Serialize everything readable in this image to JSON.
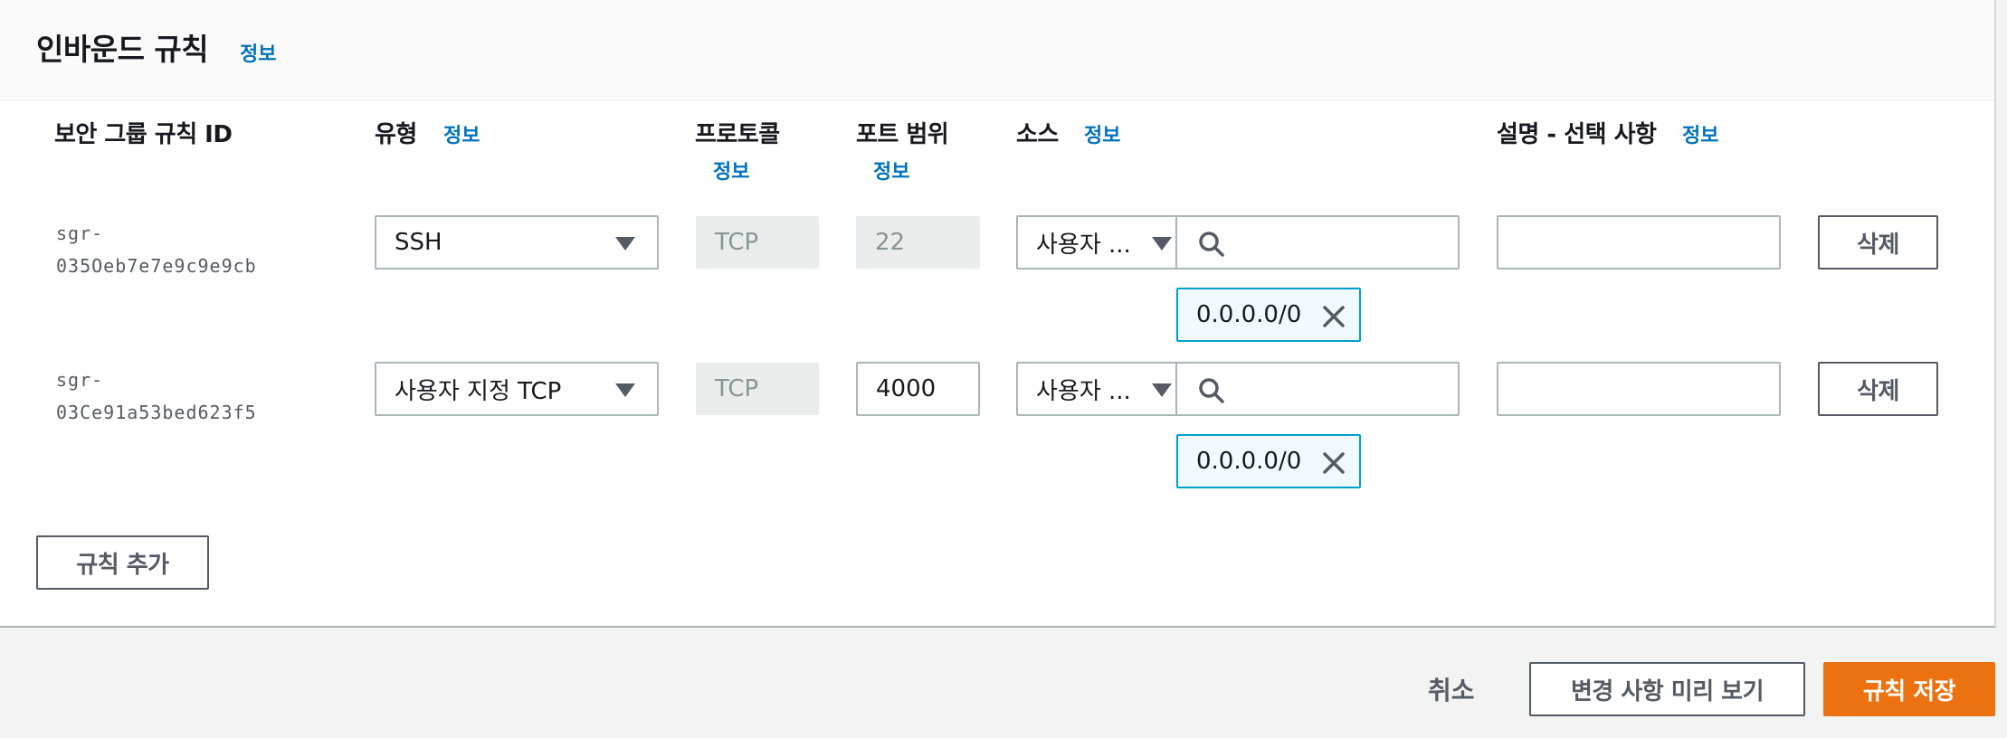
{
  "panel": {
    "title": "인바운드 규칙",
    "info": "정보"
  },
  "columns": {
    "rule_id": "보안 그룹 규칙 ID",
    "type": "유형",
    "protocol": "프로토콜",
    "port_range": "포트 범위",
    "source": "소스",
    "description": "설명 - 선택 사항",
    "info": "정보"
  },
  "rules": [
    {
      "id_line1": "sgr-",
      "id_line2": "035Oeb7e7e9c9e9cb",
      "type": "SSH",
      "protocol": "TCP",
      "port": "22",
      "port_editable": false,
      "source_type": "사용자 ...",
      "source_search": "",
      "token": "0.0.0.0/0",
      "description": "",
      "delete": "삭제"
    },
    {
      "id_line1": "sgr-",
      "id_line2": "03Ce91a53bed623f5",
      "type": "사용자 지정 TCP",
      "protocol": "TCP",
      "port": "4000",
      "port_editable": true,
      "source_type": "사용자 ...",
      "source_search": "",
      "token": "0.0.0.0/0",
      "description": "",
      "delete": "삭제"
    }
  ],
  "add_rule": "규칙 추가",
  "footer": {
    "cancel": "취소",
    "preview": "변경 사항 미리 보기",
    "save": "규칙 저장"
  },
  "colors": {
    "primary": "#ec7211",
    "link": "#0073bb",
    "token_border": "#00a1c9"
  }
}
